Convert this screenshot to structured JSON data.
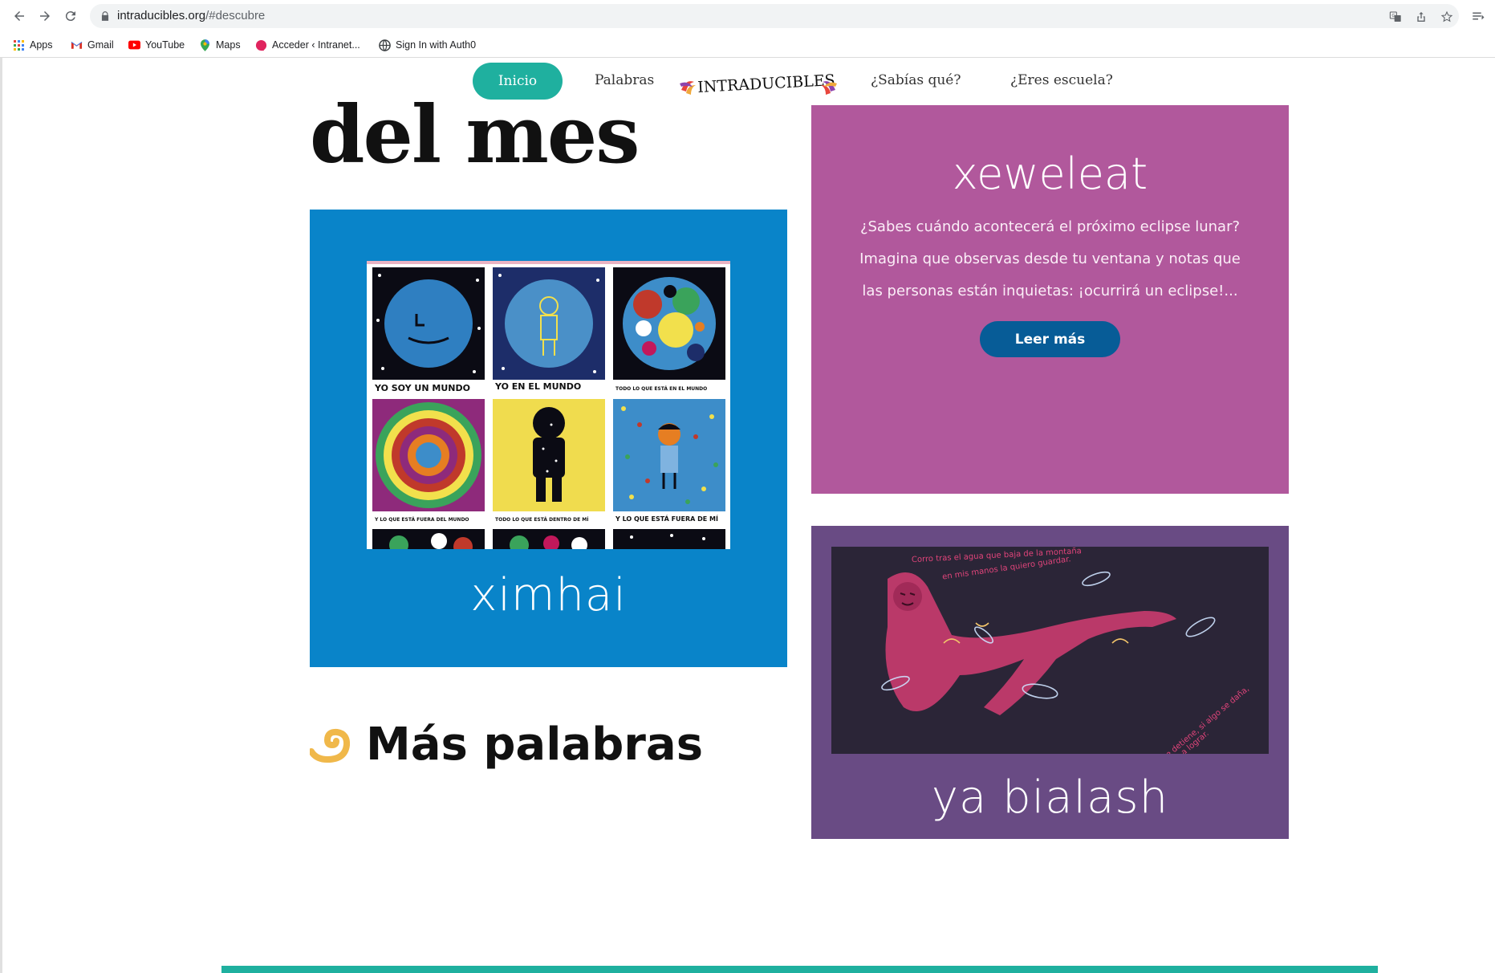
{
  "browser": {
    "url_host": "intraducibles.org",
    "url_path": "/#descubre",
    "bookmarks": [
      {
        "label": "Apps",
        "icon": "apps-grid-icon"
      },
      {
        "label": "Gmail",
        "icon": "gmail-icon"
      },
      {
        "label": "YouTube",
        "icon": "youtube-icon"
      },
      {
        "label": "Maps",
        "icon": "maps-pin-icon"
      },
      {
        "label": "Acceder ‹ Intranet...",
        "icon": "intranet-icon"
      },
      {
        "label": "Sign In with Auth0",
        "icon": "globe-icon"
      }
    ]
  },
  "site_nav": {
    "home": "Inicio",
    "words": "Palabras",
    "logo_text": "INTRADUCIBLES",
    "did_you_know": "¿Sabías qué?",
    "school": "¿Eres escuela?"
  },
  "main": {
    "heading": "del mes",
    "more_words": "Más palabras",
    "cards": {
      "ximhai": {
        "word": "ximhai",
        "captions": [
          "YO SOY UN MUNDO",
          "YO EN EL MUNDO",
          "TODO LO QUE ESTÁ EN EL MUNDO",
          "Y LO QUE ESTÁ FUERA DEL MUNDO",
          "TODO LO QUE ESTÁ DENTRO DE MÍ",
          "Y LO QUE ESTÁ FUERA DE MÍ"
        ]
      },
      "xeweleat": {
        "word": "xeweleat",
        "description": "¿Sabes cuándo acontecerá el próximo eclipse lunar? Imagina que observas desde tu ventana y notas que las personas están inquietas: ¡ocurrirá un eclipse!...",
        "button": "Leer más"
      },
      "ya_bialash": {
        "word": "ya bialash",
        "text_top": "Corro tras el agua que baja de la montaña",
        "text_top2": "en mis manos la quiero guardar.",
        "text_bottom": "Nada me detiene, si algo se daña,",
        "text_bottom2": "yo lo voy a lograr."
      }
    }
  },
  "colors": {
    "teal": "#1fb09f",
    "blue_card": "#0984c9",
    "pink_card": "#b1589c",
    "purple_card": "#694b84",
    "button_blue": "#075c97"
  }
}
